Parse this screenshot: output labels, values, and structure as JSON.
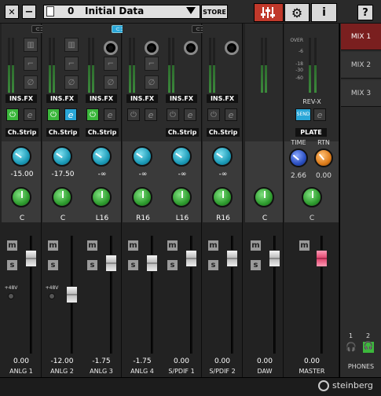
{
  "toolbar": {
    "close_label": "✕",
    "minimize_label": "−",
    "scene_number": "0",
    "scene_name": "Initial Data",
    "store_label": "STORE",
    "help_label": "?"
  },
  "colors": {
    "accent_red": "#c0392b",
    "cyan": "#2aa7d8",
    "green": "#3cb83c",
    "fader_red": "#e14a72"
  },
  "channels": [
    {
      "name": "ANLG 1",
      "insfx": "INS.FX",
      "chstrip": "Ch.Strip",
      "send": "-15.00",
      "pan": "C",
      "level": "0.00",
      "phantom": "+48V",
      "link": "⊂⊃",
      "pwr_on": true,
      "e_on": false,
      "send_color": "cyan"
    },
    {
      "name": "ANLG 2",
      "insfx": "INS.FX",
      "chstrip": "Ch.Strip",
      "send": "-17.50",
      "pan": "C",
      "level": "-12.00",
      "phantom": "+48V",
      "link": "",
      "pwr_on": true,
      "e_on": true,
      "send_color": "cyan"
    },
    {
      "name": "ANLG 3",
      "insfx": "INS.FX",
      "chstrip": "Ch.Strip",
      "send": "-∞",
      "pan": "L16",
      "level": "-1.75",
      "phantom": "",
      "link": "⊂⊃",
      "pwr_on": true,
      "e_on": false,
      "send_color": "cyan"
    },
    {
      "name": "ANLG 4",
      "insfx": "INS.FX",
      "chstrip": "",
      "send": "-∞",
      "pan": "R16",
      "level": "-1.75",
      "phantom": "",
      "link": "",
      "pwr_on": false,
      "e_on": false,
      "send_color": "cyan"
    },
    {
      "name": "S/PDIF 1",
      "insfx": "INS.FX",
      "chstrip": "Ch.Strip",
      "send": "-∞",
      "pan": "L16",
      "level": "0.00",
      "phantom": "",
      "link": "⊂⊃",
      "pwr_on": false,
      "e_on": false,
      "send_color": "cyan"
    },
    {
      "name": "S/PDIF 2",
      "insfx": "INS.FX",
      "chstrip": "Ch.Strip",
      "send": "-∞",
      "pan": "R16",
      "level": "0.00",
      "phantom": "",
      "link": "",
      "pwr_on": false,
      "e_on": false,
      "send_color": "cyan"
    },
    {
      "name": "DAW",
      "pan": "C",
      "level": "0.00"
    }
  ],
  "master": {
    "name": "MASTER",
    "level": "0.00",
    "pan": "C",
    "meter_scale": [
      "OVER",
      "-6",
      "-18",
      "-30",
      "-60"
    ],
    "revx": "REV-X",
    "send_label": "SEND",
    "preset": "PLATE",
    "time_label": "TIME",
    "rtn_label": "RTN",
    "time_val": "2.66",
    "rtn_val": "0.00"
  },
  "mix_tabs": [
    "MIX 1",
    "MIX 2",
    "MIX 3"
  ],
  "phones": {
    "label": "PHONES",
    "ch1": "1",
    "ch2": "2"
  },
  "brand": "steinberg",
  "ms": {
    "m": "m",
    "s": "s"
  }
}
